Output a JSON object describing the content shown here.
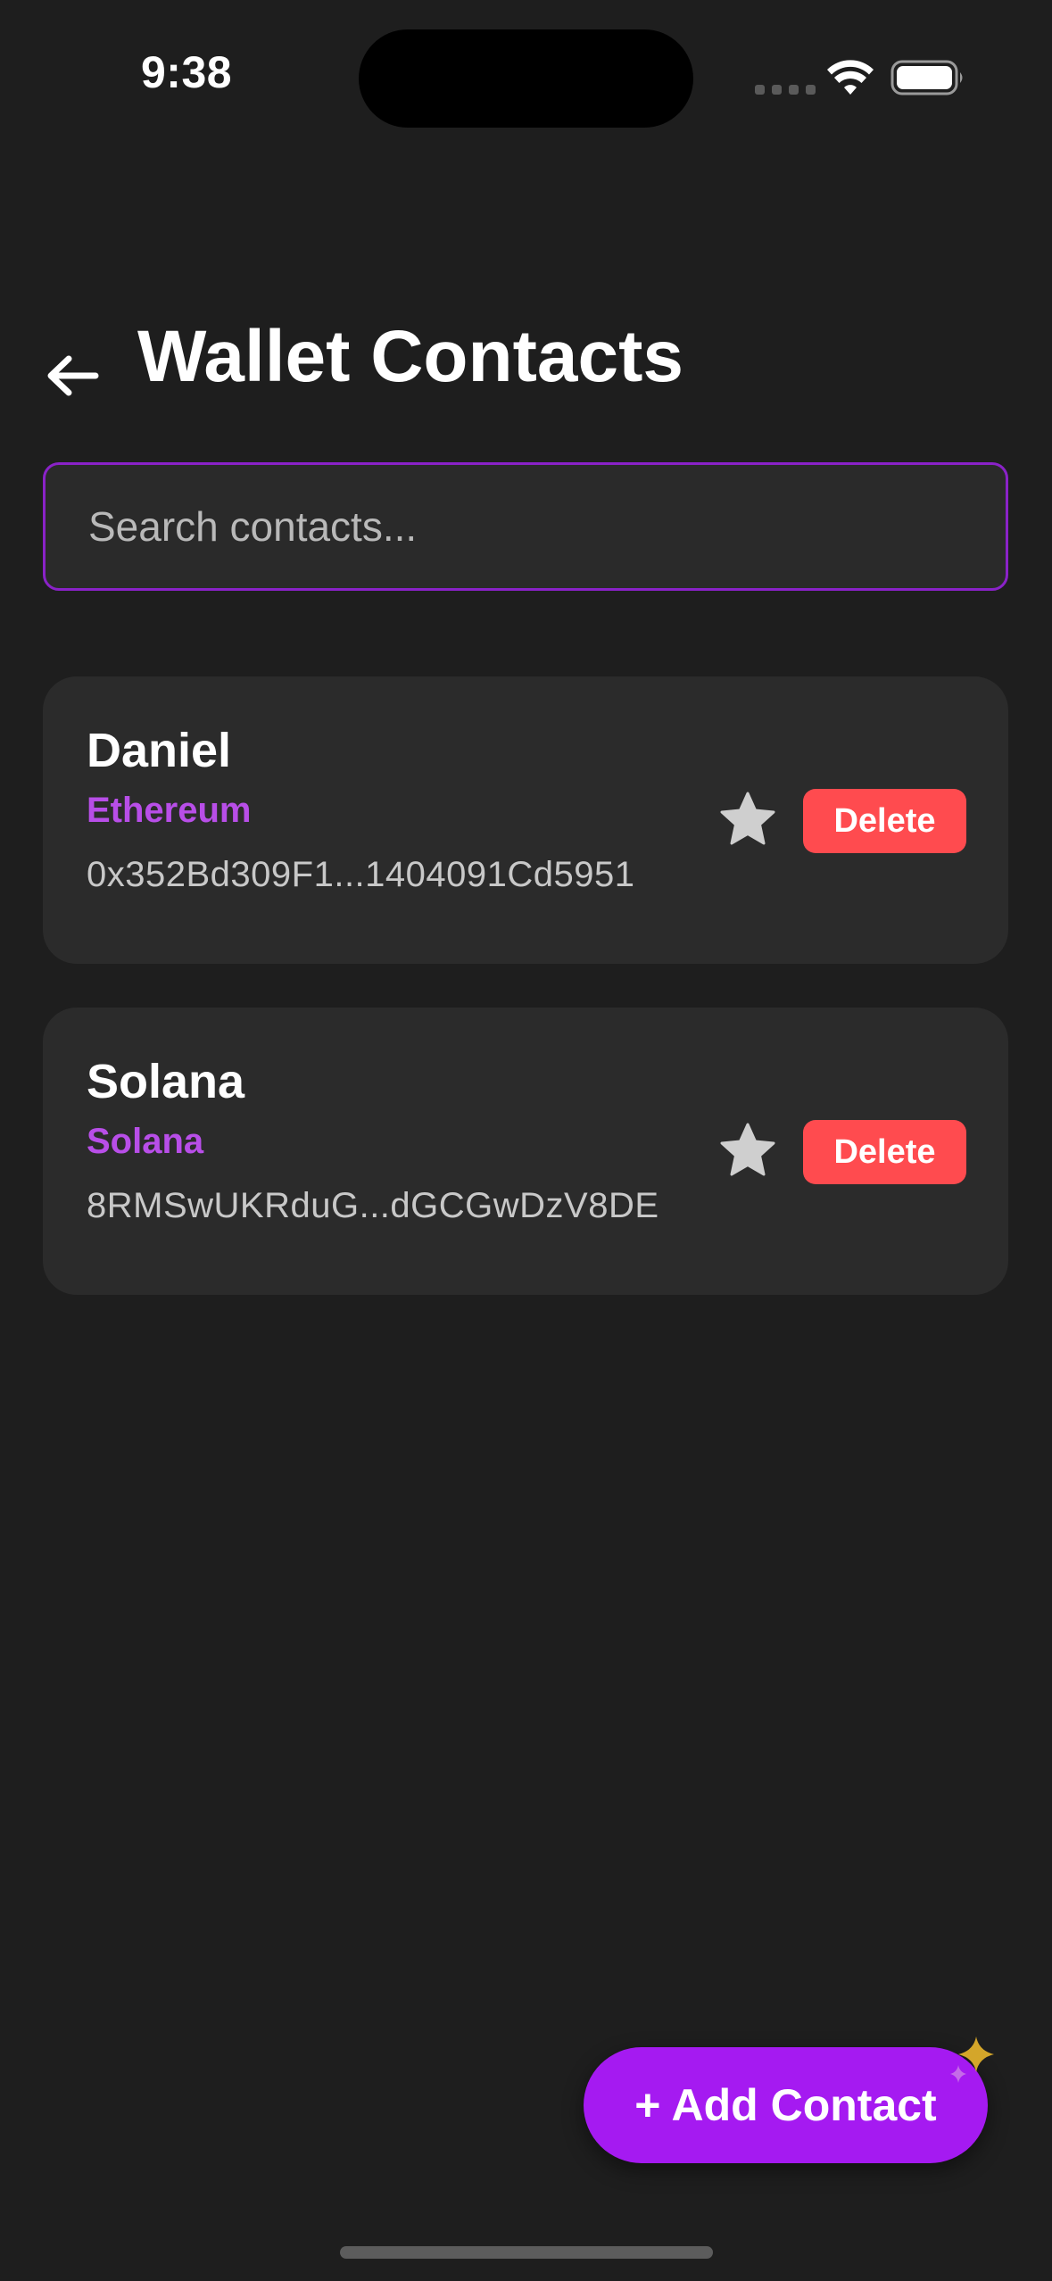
{
  "status_bar": {
    "time": "9:38",
    "icons": [
      "cellular-icon",
      "wifi-icon",
      "battery-icon"
    ]
  },
  "header": {
    "back_icon": "arrow-left-icon",
    "title": "Wallet Contacts"
  },
  "search": {
    "placeholder": "Search contacts...",
    "value": ""
  },
  "contacts": [
    {
      "name": "Daniel",
      "network": "Ethereum",
      "address": "0x352Bd309F1...1404091Cd5951",
      "favorite_icon": "star-icon",
      "delete_label": "Delete"
    },
    {
      "name": "Solana",
      "network": "Solana",
      "address": "8RMSwUKRduG...dGCGwDzV8DE",
      "favorite_icon": "star-icon",
      "delete_label": "Delete"
    }
  ],
  "fab": {
    "label": "+ Add Contact",
    "decoration_icon": "sparkle-icon"
  },
  "colors": {
    "background": "#1e1e1e",
    "card": "#2b2b2b",
    "accent": "#a51af1",
    "network_text": "#b84ee8",
    "search_border": "#8a22c8",
    "delete": "#ff4b4f",
    "star": "#cfcfcf"
  }
}
